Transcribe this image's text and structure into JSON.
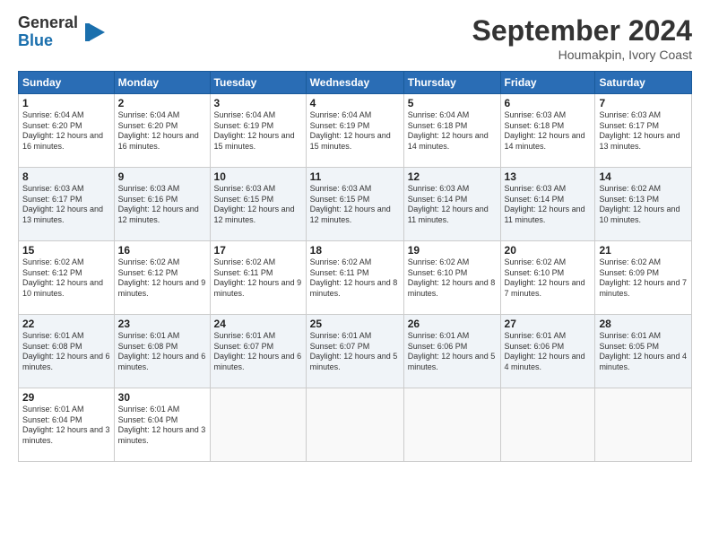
{
  "logo": {
    "general": "General",
    "blue": "Blue"
  },
  "title": "September 2024",
  "location": "Houmakpin, Ivory Coast",
  "days_header": [
    "Sunday",
    "Monday",
    "Tuesday",
    "Wednesday",
    "Thursday",
    "Friday",
    "Saturday"
  ],
  "weeks": [
    [
      {
        "day": "1",
        "sunrise": "6:04 AM",
        "sunset": "6:20 PM",
        "daylight": "12 hours and 16 minutes."
      },
      {
        "day": "2",
        "sunrise": "6:04 AM",
        "sunset": "6:20 PM",
        "daylight": "12 hours and 16 minutes."
      },
      {
        "day": "3",
        "sunrise": "6:04 AM",
        "sunset": "6:19 PM",
        "daylight": "12 hours and 15 minutes."
      },
      {
        "day": "4",
        "sunrise": "6:04 AM",
        "sunset": "6:19 PM",
        "daylight": "12 hours and 15 minutes."
      },
      {
        "day": "5",
        "sunrise": "6:04 AM",
        "sunset": "6:18 PM",
        "daylight": "12 hours and 14 minutes."
      },
      {
        "day": "6",
        "sunrise": "6:03 AM",
        "sunset": "6:18 PM",
        "daylight": "12 hours and 14 minutes."
      },
      {
        "day": "7",
        "sunrise": "6:03 AM",
        "sunset": "6:17 PM",
        "daylight": "12 hours and 13 minutes."
      }
    ],
    [
      {
        "day": "8",
        "sunrise": "6:03 AM",
        "sunset": "6:17 PM",
        "daylight": "12 hours and 13 minutes."
      },
      {
        "day": "9",
        "sunrise": "6:03 AM",
        "sunset": "6:16 PM",
        "daylight": "12 hours and 12 minutes."
      },
      {
        "day": "10",
        "sunrise": "6:03 AM",
        "sunset": "6:15 PM",
        "daylight": "12 hours and 12 minutes."
      },
      {
        "day": "11",
        "sunrise": "6:03 AM",
        "sunset": "6:15 PM",
        "daylight": "12 hours and 12 minutes."
      },
      {
        "day": "12",
        "sunrise": "6:03 AM",
        "sunset": "6:14 PM",
        "daylight": "12 hours and 11 minutes."
      },
      {
        "day": "13",
        "sunrise": "6:03 AM",
        "sunset": "6:14 PM",
        "daylight": "12 hours and 11 minutes."
      },
      {
        "day": "14",
        "sunrise": "6:02 AM",
        "sunset": "6:13 PM",
        "daylight": "12 hours and 10 minutes."
      }
    ],
    [
      {
        "day": "15",
        "sunrise": "6:02 AM",
        "sunset": "6:12 PM",
        "daylight": "12 hours and 10 minutes."
      },
      {
        "day": "16",
        "sunrise": "6:02 AM",
        "sunset": "6:12 PM",
        "daylight": "12 hours and 9 minutes."
      },
      {
        "day": "17",
        "sunrise": "6:02 AM",
        "sunset": "6:11 PM",
        "daylight": "12 hours and 9 minutes."
      },
      {
        "day": "18",
        "sunrise": "6:02 AM",
        "sunset": "6:11 PM",
        "daylight": "12 hours and 8 minutes."
      },
      {
        "day": "19",
        "sunrise": "6:02 AM",
        "sunset": "6:10 PM",
        "daylight": "12 hours and 8 minutes."
      },
      {
        "day": "20",
        "sunrise": "6:02 AM",
        "sunset": "6:10 PM",
        "daylight": "12 hours and 7 minutes."
      },
      {
        "day": "21",
        "sunrise": "6:02 AM",
        "sunset": "6:09 PM",
        "daylight": "12 hours and 7 minutes."
      }
    ],
    [
      {
        "day": "22",
        "sunrise": "6:01 AM",
        "sunset": "6:08 PM",
        "daylight": "12 hours and 6 minutes."
      },
      {
        "day": "23",
        "sunrise": "6:01 AM",
        "sunset": "6:08 PM",
        "daylight": "12 hours and 6 minutes."
      },
      {
        "day": "24",
        "sunrise": "6:01 AM",
        "sunset": "6:07 PM",
        "daylight": "12 hours and 6 minutes."
      },
      {
        "day": "25",
        "sunrise": "6:01 AM",
        "sunset": "6:07 PM",
        "daylight": "12 hours and 5 minutes."
      },
      {
        "day": "26",
        "sunrise": "6:01 AM",
        "sunset": "6:06 PM",
        "daylight": "12 hours and 5 minutes."
      },
      {
        "day": "27",
        "sunrise": "6:01 AM",
        "sunset": "6:06 PM",
        "daylight": "12 hours and 4 minutes."
      },
      {
        "day": "28",
        "sunrise": "6:01 AM",
        "sunset": "6:05 PM",
        "daylight": "12 hours and 4 minutes."
      }
    ],
    [
      {
        "day": "29",
        "sunrise": "6:01 AM",
        "sunset": "6:04 PM",
        "daylight": "12 hours and 3 minutes."
      },
      {
        "day": "30",
        "sunrise": "6:01 AM",
        "sunset": "6:04 PM",
        "daylight": "12 hours and 3 minutes."
      },
      null,
      null,
      null,
      null,
      null
    ]
  ],
  "labels": {
    "sunrise": "Sunrise:",
    "sunset": "Sunset:",
    "daylight": "Daylight:"
  }
}
